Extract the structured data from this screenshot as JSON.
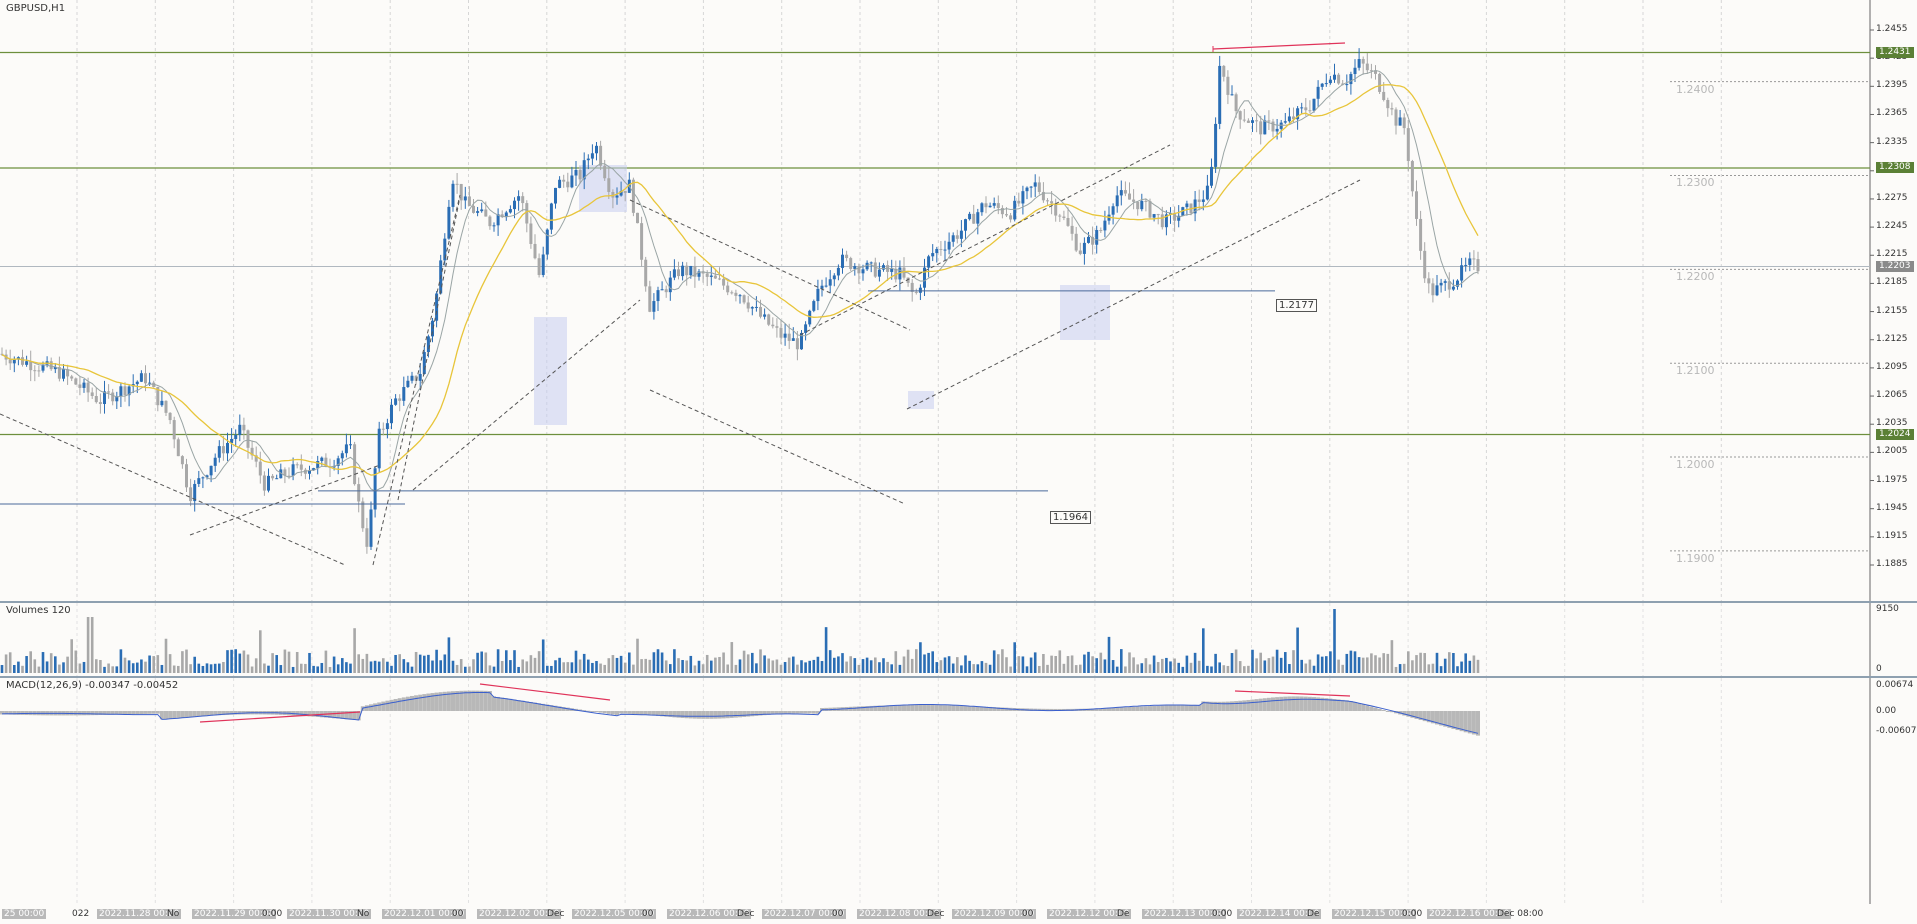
{
  "chart_title": "GBPUSD,H1",
  "colors": {
    "bull": "#2a6db4",
    "bear": "#a8a8a8",
    "fast_ma": "#9aa5a5",
    "slow_ma": "#e8c53a",
    "level": "#6d8f3d",
    "divergence": "#e0335a",
    "macd_line": "#3a5fcd",
    "macd_hist": "#b8b8b8",
    "zone": "#c7cdf0"
  },
  "price_axis": {
    "ticks": [
      "1.2455",
      "1.2425",
      "1.2395",
      "1.2365",
      "1.2335",
      "1.2305",
      "1.2275",
      "1.2245",
      "1.2215",
      "1.2185",
      "1.2155",
      "1.2125",
      "1.2095",
      "1.2065",
      "1.2035",
      "1.2005",
      "1.1975",
      "1.1945",
      "1.1915",
      "1.1885"
    ],
    "tags": [
      {
        "label": "1.2431",
        "kind": "level"
      },
      {
        "label": "1.2308",
        "kind": "level"
      },
      {
        "label": "1.2203",
        "kind": "bid"
      },
      {
        "label": "1.2024",
        "kind": "level"
      }
    ]
  },
  "round_levels": [
    "1.2400",
    "1.2300",
    "1.2200",
    "1.2100",
    "1.2000",
    "1.1900"
  ],
  "level_labels": [
    "1.2177",
    "1.1964"
  ],
  "volumes": {
    "title": "Volumes 120",
    "ticks": [
      "9150",
      "0"
    ]
  },
  "macd": {
    "title": "MACD(12,26,9) -0.00347 -0.00452",
    "ticks": [
      "0.00674",
      "0.00",
      "-0.00607"
    ]
  },
  "time_axis": [
    {
      "label": "25 00:00",
      "hi": true
    },
    {
      "label": "022",
      "hi": false
    },
    {
      "label": "2022.11.28 00:00",
      "hi": true
    },
    {
      "label": "No",
      "hi": false
    },
    {
      "label": "2022.11.29 00:00",
      "hi": true
    },
    {
      "label": "0:00",
      "hi": false
    },
    {
      "label": "2022.11.30 00:00",
      "hi": true
    },
    {
      "label": "No",
      "hi": false
    },
    {
      "label": "2022.12.01 00:00",
      "hi": true
    },
    {
      "label": "00",
      "hi": false
    },
    {
      "label": "2022.12.02 00:00",
      "hi": true
    },
    {
      "label": "Dec",
      "hi": false
    },
    {
      "label": "2022.12.05 00:00",
      "hi": true
    },
    {
      "label": "00",
      "hi": false
    },
    {
      "label": "2022.12.06 00:00",
      "hi": true
    },
    {
      "label": "Dec",
      "hi": false
    },
    {
      "label": "2022.12.07 00:00",
      "hi": true
    },
    {
      "label": "00",
      "hi": false
    },
    {
      "label": "2022.12.08 00:00",
      "hi": true
    },
    {
      "label": "Dec",
      "hi": false
    },
    {
      "label": "2022.12.09 00:00",
      "hi": true
    },
    {
      "label": "00",
      "hi": false
    },
    {
      "label": "2022.12.12 00:00",
      "hi": true
    },
    {
      "label": "De",
      "hi": false
    },
    {
      "label": "2022.12.13 00:00",
      "hi": true
    },
    {
      "label": "0:00",
      "hi": false
    },
    {
      "label": "2022.12.14 00:00",
      "hi": true
    },
    {
      "label": "De",
      "hi": false
    },
    {
      "label": "2022.12.15 00:00",
      "hi": true
    },
    {
      "label": "0:00",
      "hi": false
    },
    {
      "label": "2022.12.16 00:00",
      "hi": true
    },
    {
      "label": "Dec 08:00",
      "hi": false
    }
  ]
}
